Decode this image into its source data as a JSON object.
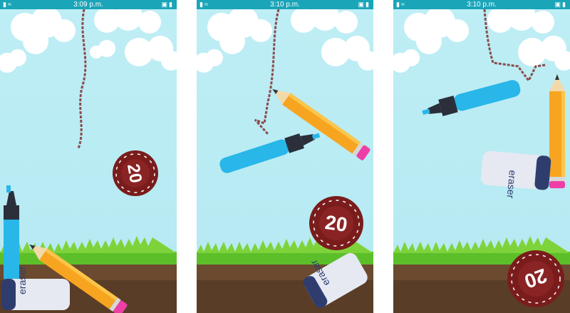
{
  "screens": [
    {
      "time": "3:09 p.m."
    },
    {
      "time": "3:10 p.m."
    },
    {
      "time": "3:10 p.m."
    }
  ],
  "status_icons_left": [
    "signal-icon",
    "wifi-icon"
  ],
  "status_icons_right": [
    "sync-icon",
    "image-icon",
    "battery-icon"
  ],
  "chip_value": "20",
  "eraser_label": "eraser",
  "colors": {
    "status_bar": "#1aa5b8",
    "sky": "#bfeef5",
    "grass": "#5cbf2a",
    "soil": "#6b4a2f",
    "chip": "#7a1c1c",
    "marker": "#29b6e8",
    "pencil": "#f7a520",
    "eraser": "#e6e9f2",
    "eraser_band": "#2f3d6e"
  }
}
